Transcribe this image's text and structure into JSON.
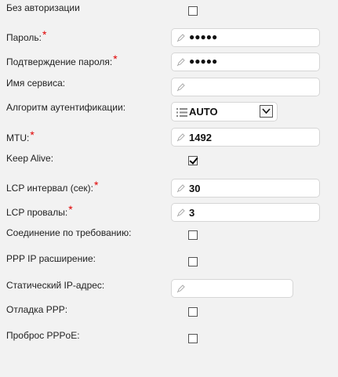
{
  "form": {
    "no_auth": {
      "label": "Без авторизации",
      "checked": false
    },
    "password": {
      "label": "Пароль:",
      "required": "*",
      "value": "●●●●●"
    },
    "password_confirm": {
      "label": "Подтверждение пароля:",
      "required": "*",
      "value": "●●●●●"
    },
    "service_name": {
      "label": "Имя сервиса:",
      "value": ""
    },
    "auth_algorithm": {
      "label": "Алгоритм аутентификации:",
      "value": "AUTO"
    },
    "mtu": {
      "label": "MTU:",
      "required": "*",
      "value": "1492"
    },
    "keep_alive": {
      "label": "Keep Alive:",
      "checked": true
    },
    "lcp_interval": {
      "label": "LCP интервал (сек):",
      "required": "*",
      "value": "30"
    },
    "lcp_failures": {
      "label": "LCP провалы:",
      "required": "*",
      "value": "3"
    },
    "on_demand": {
      "label": "Соединение по требованию:",
      "checked": false
    },
    "ppp_ip_ext": {
      "label": "PPP IP расширение:",
      "checked": false
    },
    "static_ip": {
      "label": "Статический IP-адрес:",
      "value": ""
    },
    "ppp_debug": {
      "label": "Отладка PPP:",
      "checked": false
    },
    "pppoe_passthrough": {
      "label": "Проброс PPPoE:",
      "checked": false
    }
  },
  "icons": {
    "field_icon": "pencil-icon",
    "select_icon": "list-icon",
    "select_arrow": "chevron-down-icon"
  },
  "colors": {
    "background": "#f2f2f2",
    "required_mark": "#e00000",
    "field_border": "#d6d6d6"
  }
}
